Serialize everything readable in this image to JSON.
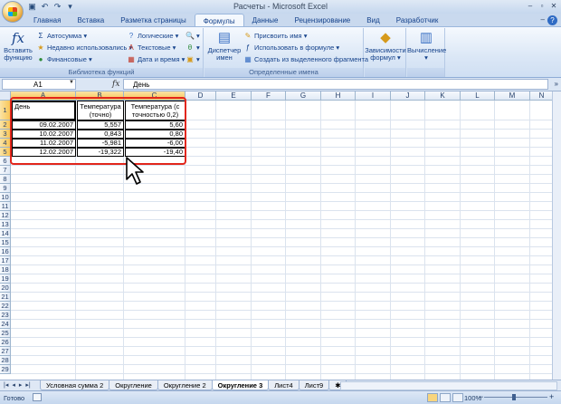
{
  "window": {
    "title": "Расчеты - Microsoft Excel"
  },
  "quick_access": [
    {
      "name": "save-icon",
      "glyph": "▣"
    },
    {
      "name": "undo-icon",
      "glyph": "↶"
    },
    {
      "name": "redo-icon",
      "glyph": "↷"
    },
    {
      "name": "customize-icon",
      "glyph": "▾"
    }
  ],
  "tabs": [
    "Главная",
    "Вставка",
    "Разметка страницы",
    "Формулы",
    "Данные",
    "Рецензирование",
    "Вид",
    "Разработчик"
  ],
  "active_tab": "Формулы",
  "ribbon": {
    "insert_function": {
      "line1": "Вставить",
      "line2": "функцию",
      "glyph": "fx"
    },
    "autosum": "Автосумма",
    "recent": "Недавно использовались",
    "financial": "Финансовые",
    "logical": "Логические",
    "text": "Текстовые",
    "datetime": "Дата и время",
    "library_label": "Библиотека функций",
    "name_manager": {
      "line1": "Диспетчер",
      "line2": "имен"
    },
    "define_name": "Присвоить имя",
    "use_in_formula": "Использовать в формуле",
    "create_from_selection": "Создать из выделенного фрагмента",
    "names_label": "Определенные имена",
    "dependencies": {
      "line1": "Зависимости",
      "line2": "формул"
    },
    "calculation": "Вычисление"
  },
  "formula_bar": {
    "cell_ref": "A1",
    "fx": "fx",
    "content": "День"
  },
  "columns": [
    "A",
    "B",
    "C",
    "D",
    "E",
    "F",
    "G",
    "H",
    "I",
    "J",
    "K",
    "L",
    "M",
    "N"
  ],
  "rows": [
    "1",
    "2",
    "3",
    "4",
    "5",
    "6",
    "7",
    "8",
    "9",
    "10",
    "11",
    "12",
    "13",
    "14",
    "15",
    "16",
    "17",
    "18",
    "19",
    "20",
    "21",
    "22",
    "23",
    "24",
    "25",
    "26",
    "27",
    "28",
    "29"
  ],
  "table": {
    "headers": [
      "День",
      "Температура (точно)",
      "Температура (с точностью 0,2)"
    ],
    "rows": [
      [
        "09.02.2007",
        "5,557",
        "5,60"
      ],
      [
        "10.02.2007",
        "0,843",
        "0,80"
      ],
      [
        "11.02.2007",
        "-5,981",
        "-6,00"
      ],
      [
        "12.02.2007",
        "-19,322",
        "-19,40"
      ]
    ]
  },
  "sheet_tabs": [
    "Условная сумма 2",
    "Округление",
    "Округление 2",
    "Округление 3",
    "Лист4",
    "Лист9"
  ],
  "active_sheet": "Округление 3",
  "status": {
    "ready": "Готово",
    "zoom": "100%"
  },
  "colors": {
    "highlight": "#e2261c",
    "selected_header": "#f8c759"
  }
}
